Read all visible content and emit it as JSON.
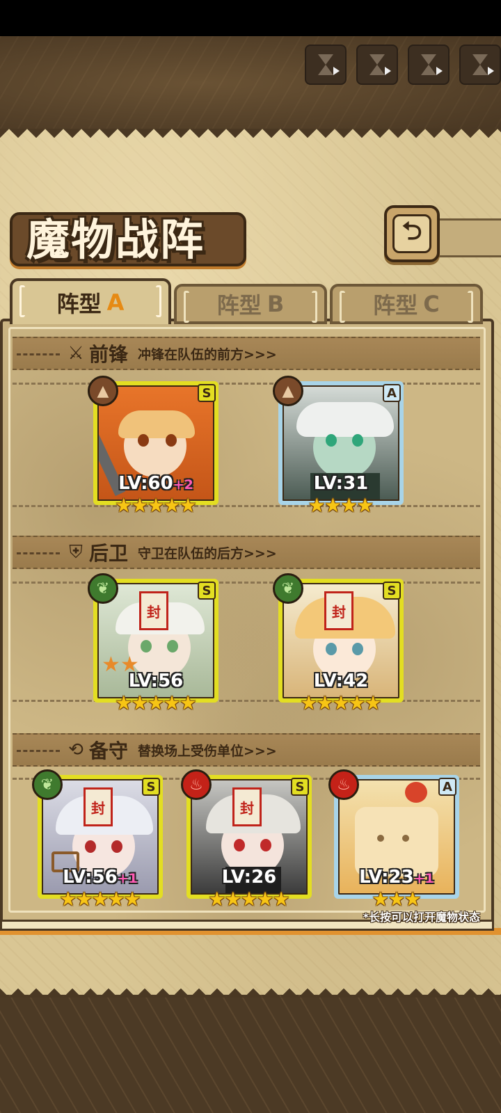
{
  "header": {
    "skip_buttons": [
      {
        "icon": "hourglass-play-icon"
      },
      {
        "icon": "hourglass-play-icon"
      },
      {
        "icon": "hourglass-play-icon"
      },
      {
        "icon": "hourglass-play-icon"
      }
    ]
  },
  "title": "魔物战阵",
  "back_button": {
    "icon": "back-arrow-icon",
    "glyph": "⮌"
  },
  "tabs": [
    {
      "label": "阵型",
      "letter": "A",
      "active": true
    },
    {
      "label": "阵型",
      "letter": "B",
      "active": false
    },
    {
      "label": "阵型",
      "letter": "C",
      "active": false
    }
  ],
  "sections": {
    "front": {
      "icon": "sword-icon",
      "glyph": "⚔",
      "name": "前锋",
      "desc": "冲锋在队伍的前方>>>"
    },
    "back": {
      "icon": "shield-icon",
      "glyph": "⛨",
      "name": "后卫",
      "desc": "守卫在队伍的后方>>>"
    },
    "reserve": {
      "icon": "swap-icon",
      "glyph": "⟲",
      "name": "备守",
      "desc": "替换场上受伤单位>>>"
    }
  },
  "cards": {
    "front_1": {
      "rank": "S",
      "element": "mountain",
      "level": "LV:60",
      "bonus": "+2",
      "stars": 5,
      "sealed": false
    },
    "front_2": {
      "rank": "A",
      "element": "mountain",
      "level": "LV:31",
      "bonus": "",
      "stars": 4,
      "sealed": false
    },
    "back_1": {
      "rank": "S",
      "element": "leaf",
      "level": "LV:56",
      "bonus": "",
      "stars": 5,
      "sealed": true
    },
    "back_2": {
      "rank": "S",
      "element": "leaf",
      "level": "LV:42",
      "bonus": "",
      "stars": 5,
      "sealed": true
    },
    "reserve_1": {
      "rank": "S",
      "element": "leaf",
      "level": "LV:56",
      "bonus": "+1",
      "stars": 5,
      "sealed": true
    },
    "reserve_2": {
      "rank": "S",
      "element": "fire",
      "level": "LV:26",
      "bonus": "",
      "stars": 5,
      "sealed": true
    },
    "reserve_3": {
      "rank": "A",
      "element": "fire",
      "level": "LV:23",
      "bonus": "+1",
      "stars": 3,
      "sealed": false
    }
  },
  "seal_glyph": "封",
  "hint": "*长按可以打开魔物状态",
  "colors": {
    "s_frame": "#e3de22",
    "a_frame": "#a8d4e8",
    "accent": "#e68a14"
  }
}
